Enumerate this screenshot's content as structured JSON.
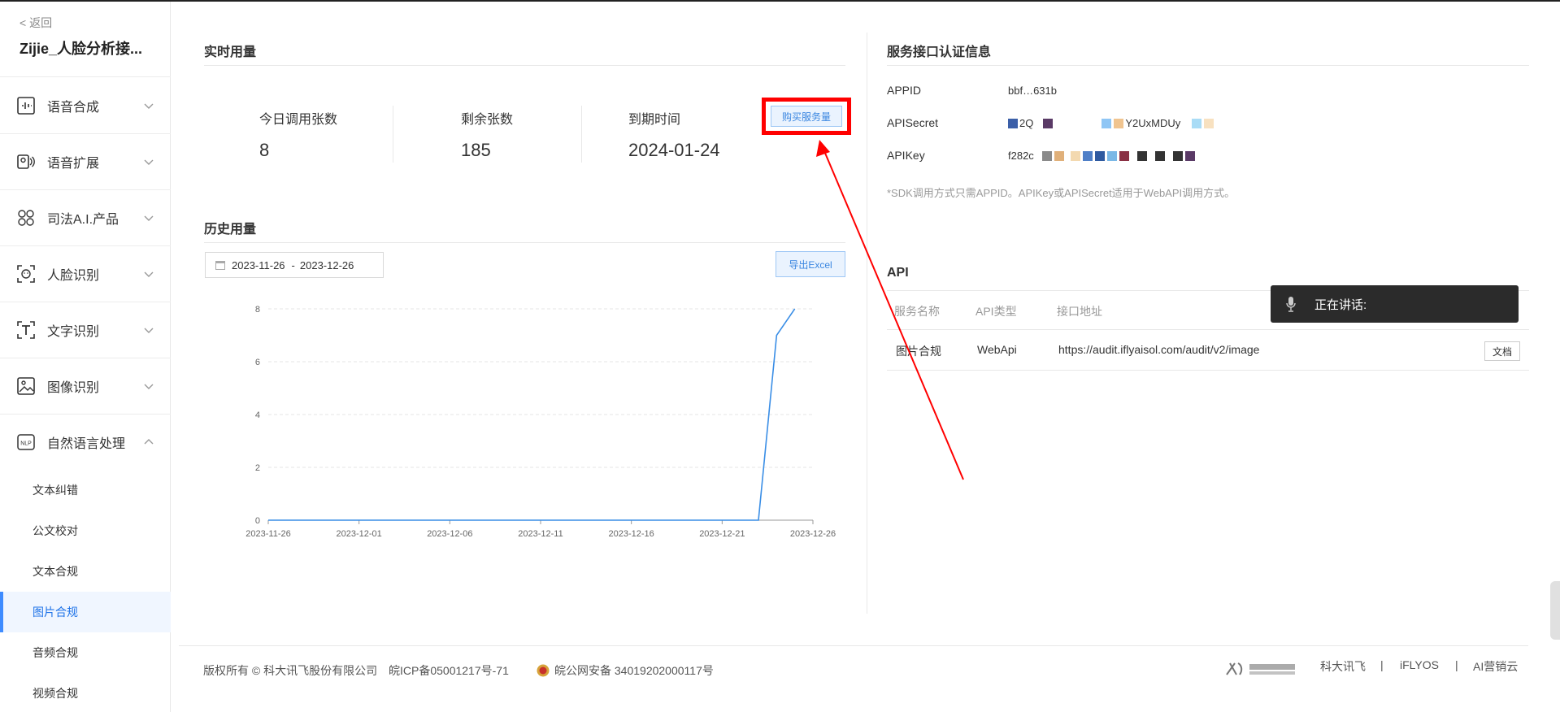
{
  "sidebar": {
    "back": "< 返回",
    "title": "Zijie_人脸分析接...",
    "items": [
      {
        "label": "语音合成",
        "icon": "tts-icon"
      },
      {
        "label": "语音扩展",
        "icon": "voice-extend-icon"
      },
      {
        "label": "司法A.I.产品",
        "icon": "justice-icon"
      },
      {
        "label": "人脸识别",
        "icon": "face-icon"
      },
      {
        "label": "文字识别",
        "icon": "text-recognition-icon"
      },
      {
        "label": "图像识别",
        "icon": "image-icon"
      },
      {
        "label": "自然语言处理",
        "icon": "nlp-icon"
      }
    ],
    "subitems": [
      "文本纠错",
      "公文校对",
      "文本合规",
      "图片合规",
      "音频合规",
      "视频合规"
    ],
    "active_subitem": "图片合规"
  },
  "realtime": {
    "title": "实时用量",
    "today_label": "今日调用张数",
    "today_value": "8",
    "remain_label": "剩余张数",
    "remain_value": "185",
    "expire_label": "到期时间",
    "expire_value": "2024-01-24",
    "buy_label": "购买服务量"
  },
  "history": {
    "title": "历史用量",
    "date_start": "2023-11-26",
    "date_sep": "-",
    "date_end": "2023-12-26",
    "export_label": "导出Excel"
  },
  "chart_data": {
    "type": "line",
    "x": [
      "2023-11-26",
      "2023-11-27",
      "2023-11-28",
      "2023-11-29",
      "2023-11-30",
      "2023-12-01",
      "2023-12-02",
      "2023-12-03",
      "2023-12-04",
      "2023-12-05",
      "2023-12-06",
      "2023-12-07",
      "2023-12-08",
      "2023-12-09",
      "2023-12-10",
      "2023-12-11",
      "2023-12-12",
      "2023-12-13",
      "2023-12-14",
      "2023-12-15",
      "2023-12-16",
      "2023-12-17",
      "2023-12-18",
      "2023-12-19",
      "2023-12-20",
      "2023-12-21",
      "2023-12-22",
      "2023-12-23",
      "2023-12-24",
      "2023-12-25",
      "2023-12-26"
    ],
    "values": [
      0,
      0,
      0,
      0,
      0,
      0,
      0,
      0,
      0,
      0,
      0,
      0,
      0,
      0,
      0,
      0,
      0,
      0,
      0,
      0,
      0,
      0,
      0,
      0,
      0,
      0,
      0,
      0,
      7,
      8
    ],
    "x_ticks": [
      "2023-11-26",
      "2023-12-01",
      "2023-12-06",
      "2023-12-11",
      "2023-12-16",
      "2023-12-21",
      "2023-12-26"
    ],
    "y_ticks": [
      "0",
      "2",
      "4",
      "6",
      "8"
    ],
    "ylim": [
      0,
      8
    ],
    "color": "#3a8ee6",
    "grid": true
  },
  "auth": {
    "title": "服务接口认证信息",
    "appid_label": "APPID",
    "appid_value": "bbf…631b",
    "secret_label": "APISecret",
    "secret_value": "Y2UxMDUy",
    "key_label": "APIKey",
    "key_value": "f282c",
    "note": "*SDK调用方式只需APPID。APIKey或APISecret适用于WebAPI调用方式。"
  },
  "api": {
    "title": "API",
    "columns": [
      "服务名称",
      "API类型",
      "接口地址"
    ],
    "rows": [
      {
        "name": "图片合规",
        "type": "WebApi",
        "url": "https://audit.iflyaisol.com/audit/v2/image",
        "doc": "文档"
      }
    ]
  },
  "overlay": {
    "speaking": "正在讲话:"
  },
  "footer": {
    "copyright": "版权所有 © 科大讯飞股份有限公司",
    "icp": "皖ICP备05001217号-71",
    "police": "皖公网安备 34019202000117号",
    "links": [
      "科大讯飞",
      "iFLYOS",
      "AI营销云"
    ],
    "sep": "|"
  },
  "colors": {
    "accent": "#3a86e0",
    "highlight": "#ff0000",
    "arrow": "#ff0000"
  }
}
